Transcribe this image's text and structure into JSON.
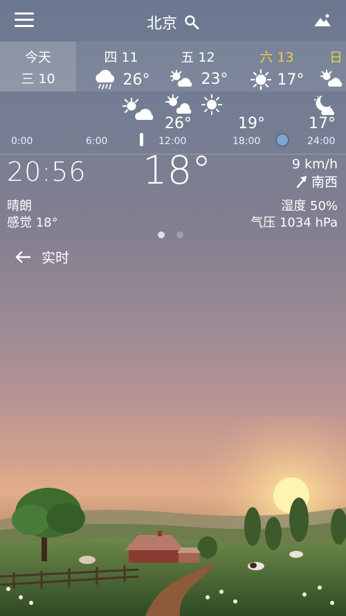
{
  "header": {
    "city": "北京",
    "menu_icon": "menu-icon",
    "search_icon": "search-icon",
    "scene_icon": "landscape-icon"
  },
  "days": [
    {
      "name": "今天",
      "date": "三 10",
      "icon": "",
      "temp": ""
    },
    {
      "name": "四 11",
      "date": "",
      "icon": "rain-icon",
      "temp": "26°"
    },
    {
      "name": "五 12",
      "date": "",
      "icon": "sun-cloud-icon",
      "temp": "23°"
    },
    {
      "name": "六 13",
      "date": "",
      "icon": "sun-icon",
      "temp": "17°",
      "color": "#f2c94c"
    },
    {
      "name": "日",
      "date": "",
      "icon": "sun-cloud-icon",
      "temp": "",
      "color": "#f2c94c"
    }
  ],
  "timeline": {
    "temps": [
      "26°",
      "19°",
      "17°"
    ],
    "labels": [
      "0:00",
      "6:00",
      "12:00",
      "18:00",
      "24:00"
    ]
  },
  "now": {
    "time": "20:56",
    "temperature": "18°",
    "wind_speed": "9 km/h",
    "wind_direction": "南西",
    "condition": "晴朗",
    "feels_like": "感觉 18°",
    "humidity": "湿度 50%",
    "pressure": "气压 1034 hPa"
  },
  "pager": {
    "count": 2,
    "active": 0
  },
  "back": {
    "label": "实时"
  },
  "colors": {
    "accent_day": "#f2c94c",
    "dot_active": "#ffffff",
    "dot_inactive": "rgba(255,255,255,0.35)"
  }
}
